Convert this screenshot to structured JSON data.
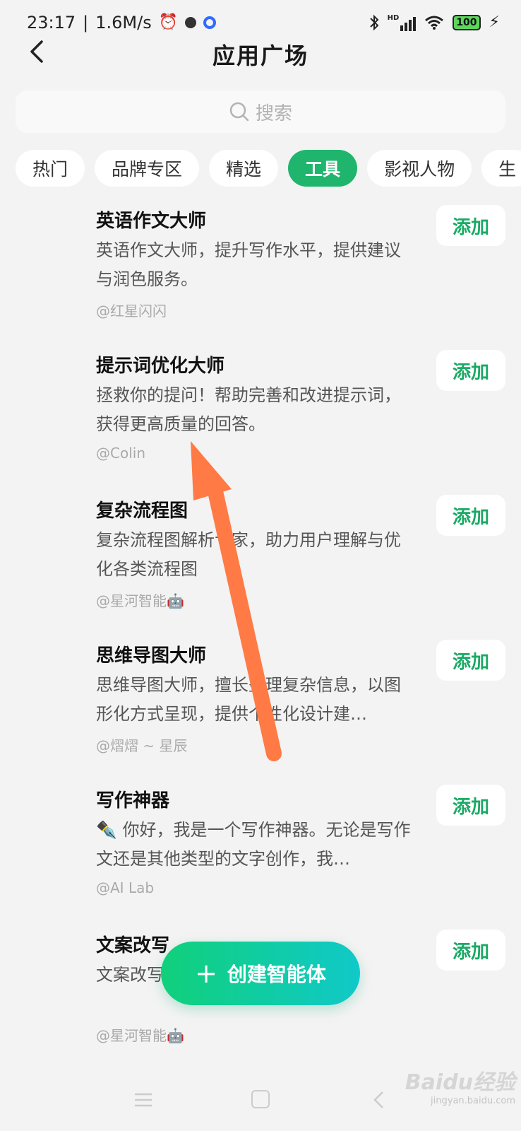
{
  "status_bar": {
    "time": "23:17",
    "net_speed": "1.6M/s",
    "battery": "100",
    "network": "HD"
  },
  "header": {
    "title": "应用广场"
  },
  "search": {
    "placeholder": "搜索"
  },
  "tabs": [
    {
      "label": "热门"
    },
    {
      "label": "品牌专区"
    },
    {
      "label": "精选"
    },
    {
      "label": "工具",
      "active": true
    },
    {
      "label": "影视人物"
    },
    {
      "label": "生"
    }
  ],
  "items": [
    {
      "title": "英语作文大师",
      "desc": "英语作文大师，提升写作水平，提供建议与润色服务。",
      "author": "@红星闪闪",
      "button": "添加"
    },
    {
      "title": "提示词优化大师",
      "desc": "拯救你的提问！帮助完善和改进提示词，获得更高质量的回答。",
      "author": "@Colin",
      "button": "添加"
    },
    {
      "title": "复杂流程图",
      "desc": "复杂流程图解析专家，助力用户理解与优化各类流程图",
      "author": "@星河智能🤖",
      "button": "添加"
    },
    {
      "title": "思维导图大师",
      "desc": "思维导图大师，擅长整理复杂信息，以图形化方式呈现，提供个性化设计建…",
      "author": "@熠熠 ~ 星辰",
      "button": "添加"
    },
    {
      "title": "写作神器",
      "desc": "✒️ 你好，我是一个写作神器。无论是写作文还是其他类型的文字创作，我…",
      "author": "@AI Lab",
      "button": "添加"
    },
    {
      "title": "文案改写",
      "desc": "文案改写，让你的内容更吸睛。",
      "author": "@星河智能🤖",
      "button": "添加"
    }
  ],
  "fab": {
    "label": "创建智能体"
  },
  "watermark": {
    "logo": "Baidu经验",
    "domain": "jingyan.baidu.com"
  },
  "colors": {
    "accent": "#1fb56d",
    "add_text": "#1aaa65",
    "arrow": "#ff7a45",
    "background": "#f3f3f3"
  }
}
